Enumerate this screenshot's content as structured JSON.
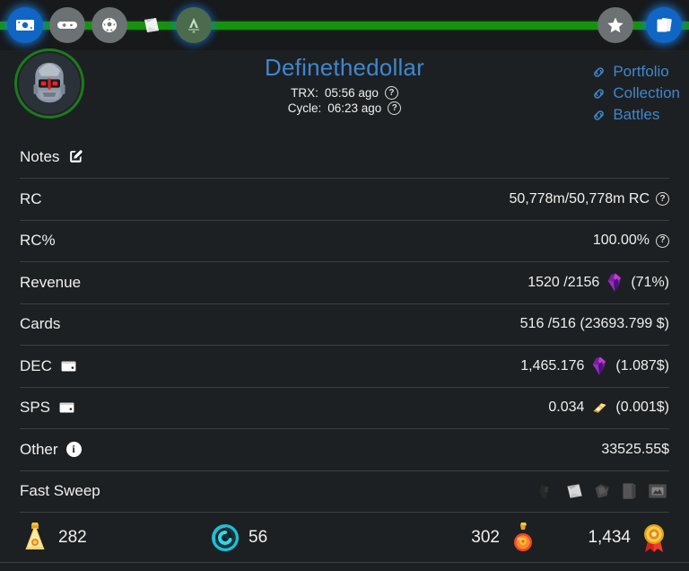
{
  "topbar": {
    "progress_percent": 100,
    "progress_color": "#17920f",
    "nav_items": [
      {
        "name": "money-icon",
        "label": "Money",
        "active": true
      },
      {
        "name": "gamepad-icon",
        "label": "Games",
        "active": false
      },
      {
        "name": "soccer-ball-icon",
        "label": "Sports",
        "active": false
      },
      {
        "name": "scroll-icon",
        "label": "Scroll",
        "active": false
      },
      {
        "name": "alpha-emblem-icon",
        "label": "Alpha",
        "active": false
      }
    ],
    "nav_items_right": [
      {
        "name": "star-icon",
        "label": "Favorites",
        "active": false
      },
      {
        "name": "cards-icon",
        "label": "Cards",
        "active": true
      }
    ]
  },
  "profile": {
    "avatar_name": "robot-avatar",
    "account_name": "Definethedollar",
    "trx_label": "TRX:",
    "trx_value": "05:56 ago",
    "cycle_label": "Cycle:",
    "cycle_value": "06:23 ago",
    "help_glyph": "?",
    "links": [
      {
        "label": "Portfolio"
      },
      {
        "label": "Collection"
      },
      {
        "label": "Battles"
      }
    ],
    "accent_color": "#3e87cf"
  },
  "rows": [
    {
      "label": "Notes",
      "label_icon": "edit-icon",
      "value": ""
    },
    {
      "label": "RC",
      "value": "50,778m/50,778m RC",
      "value_help": true
    },
    {
      "label": "RC%",
      "value": "100.00%",
      "value_help": true
    },
    {
      "label": "Revenue",
      "value": "1520 /2156",
      "token_icon": "dec-crystal-icon",
      "suffix": "(71%)"
    },
    {
      "label": "Cards",
      "value": "516 /516 (23693.799 $)"
    },
    {
      "label": "DEC",
      "label_icon": "wallet-icon",
      "value": "1,465.176",
      "token_icon": "dec-crystal-icon",
      "suffix": "(1.087$)"
    },
    {
      "label": "SPS",
      "label_icon": "wallet-icon",
      "value": "0.034",
      "token_icon": "sps-bolt-icon",
      "suffix": "(0.001$)"
    },
    {
      "label": "Other",
      "label_icon": "info-icon",
      "value": "33525.55$"
    },
    {
      "label": "Fast Sweep",
      "sweep_icons": [
        "glove-icon",
        "scroll-icon",
        "stone-icon",
        "book-icon",
        "frame-icon"
      ]
    }
  ],
  "resources": [
    {
      "icon": "legendary-potion-icon",
      "value": "282",
      "icon_first": true
    },
    {
      "icon": "merit-spiral-icon",
      "value": "56",
      "icon_first": true
    },
    {
      "icon": "alchemy-potion-icon",
      "value": "302",
      "icon_first": false
    },
    {
      "icon": "glint-medal-icon",
      "value": "1,434",
      "icon_first": false
    }
  ]
}
